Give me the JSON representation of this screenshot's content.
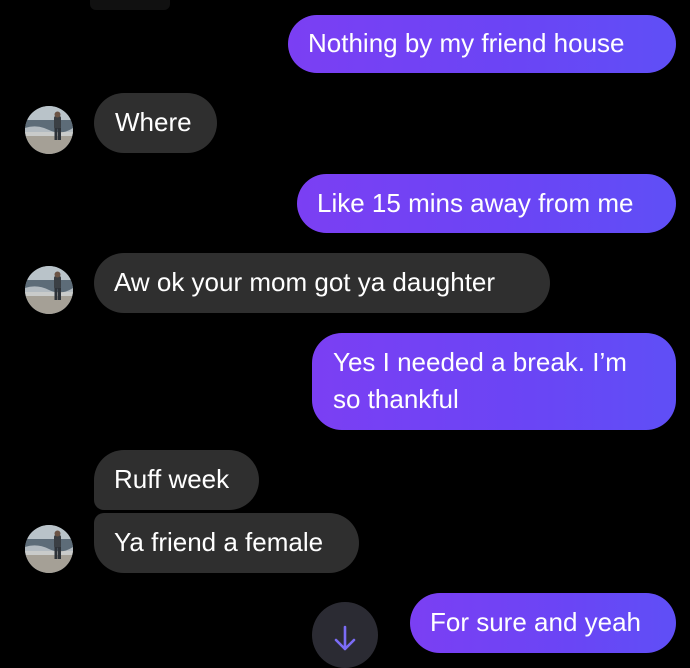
{
  "conversation": {
    "messages": [
      {
        "direction": "sent",
        "text": "Nothing by my friend house"
      },
      {
        "direction": "received",
        "text": "Where"
      },
      {
        "direction": "sent",
        "text": "Like 15 mins away from me"
      },
      {
        "direction": "received",
        "text": "Aw ok your mom got ya daughter"
      },
      {
        "direction": "sent",
        "text": "Yes I needed a break. I’m",
        "text_line2": "so thankful"
      },
      {
        "direction": "received",
        "text": "Ruff week"
      },
      {
        "direction": "received",
        "text": "Ya friend a female"
      },
      {
        "direction": "sent",
        "text": "For sure and yeah"
      }
    ]
  },
  "colors": {
    "background": "#000000",
    "sent_bubble": "#6a45f5",
    "received_bubble": "#2f2f2f",
    "text": "#ffffff",
    "scroll_arrow": "#7b6cf6"
  },
  "icons": {
    "avatar": "contact-photo-icon",
    "scroll_down": "arrow-down-icon"
  }
}
